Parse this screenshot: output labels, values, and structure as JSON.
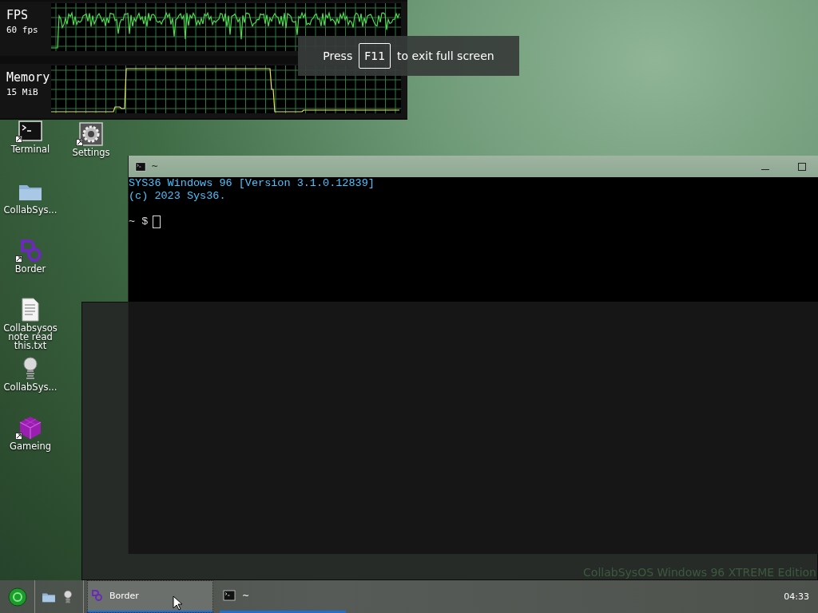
{
  "monitors": [
    {
      "kind": "fps",
      "label": "FPS",
      "reading": "60 fps"
    },
    {
      "kind": "memory",
      "label": "Memory",
      "reading": "15 MiB"
    }
  ],
  "fullscreen_hint": {
    "before": "Press",
    "key": "F11",
    "after": "to exit full screen"
  },
  "desktop_icons": [
    {
      "label": "Terminal",
      "kind": "terminal",
      "shortcut": true
    },
    {
      "label": "Settings",
      "kind": "settings",
      "shortcut": true
    },
    {
      "label": "CollabSys...",
      "kind": "folder",
      "shortcut": false
    },
    {
      "label": "Border",
      "kind": "border",
      "shortcut": true
    },
    {
      "label": "Collabsysos note read this.txt",
      "kind": "text-file",
      "shortcut": false
    },
    {
      "label": "CollabSys...",
      "kind": "spring",
      "shortcut": false
    },
    {
      "label": "Gameing",
      "kind": "cube",
      "shortcut": true
    }
  ],
  "terminal_window": {
    "title": "~",
    "lines": [
      "SYS36 Windows 96 [Version 3.1.0.12839]",
      "(c) 2023 Sys36."
    ],
    "prompt": "~ $"
  },
  "edition_text": "CollabSysOS Windows 96 XTREME Edition",
  "taskbar": {
    "quick_launch": [
      {
        "kind": "folder"
      },
      {
        "kind": "spring"
      }
    ],
    "tasks": [
      {
        "label": "Border",
        "kind": "border",
        "selected": true
      },
      {
        "label": "~",
        "kind": "terminal",
        "selected": false
      }
    ],
    "clock": "04:33"
  }
}
